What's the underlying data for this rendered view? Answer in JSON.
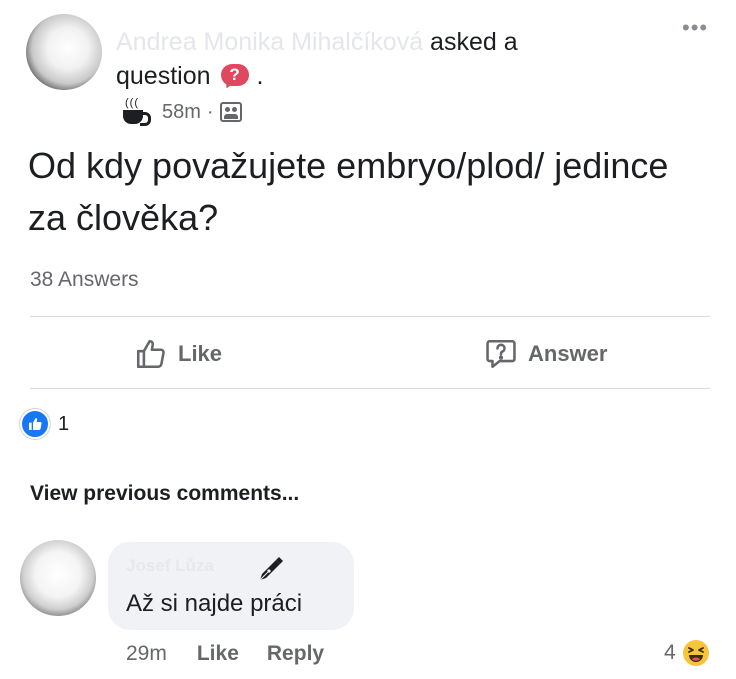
{
  "post": {
    "author_name": "Andrea Monika Mihalčíková",
    "asked_label": "asked a",
    "question_label": "question",
    "badge_symbol": "?",
    "period": ".",
    "time": "58m",
    "separator": "·",
    "question_text": "Od kdy považujete embryo/plod/ jedince za člověka?",
    "answers_count": "38 Answers",
    "reaction_count": "1"
  },
  "actions": {
    "like_label": "Like",
    "answer_label": "Answer"
  },
  "comments": {
    "view_previous_label": "View previous comments...",
    "items": [
      {
        "author": "Josef Lůza",
        "text": "Až si najde práci",
        "time": "29m",
        "like_label": "Like",
        "reply_label": "Reply",
        "reaction_count": "4"
      }
    ]
  },
  "icons": {
    "more": "more-horizontal-icon",
    "question_badge": "question-badge-icon",
    "cup": "coffee-cup-icon",
    "group": "group-privacy-icon",
    "like": "thumbs-up-icon",
    "answer": "question-bubble-icon",
    "pen": "pen-nib-icon",
    "haha": "haha-reaction-icon"
  },
  "colors": {
    "accent_blue": "#1877f2",
    "badge_red": "#e04860",
    "meta_gray": "#65676b",
    "bubble_bg": "#f0f2f5"
  }
}
